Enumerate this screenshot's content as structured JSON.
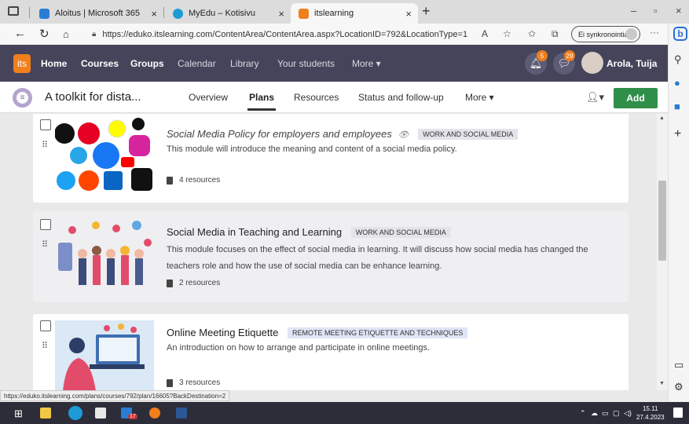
{
  "browser": {
    "tabs": [
      {
        "title": "Aloitus | Microsoft 365",
        "color": "#2b7cd3"
      },
      {
        "title": "MyEdu – Kotisivu",
        "color": "#1e9bd7"
      },
      {
        "title": "itslearning",
        "color": "#f07f1c"
      }
    ],
    "new_tab": "+",
    "url": "https://eduko.itslearning.com/ContentArea/ContentArea.aspx?LocationID=792&LocationType=1",
    "sync_label": "Ei synkronointia",
    "menu": "···"
  },
  "its_nav": {
    "logo": "its",
    "items": [
      "Home",
      "Courses",
      "Groups",
      "Calendar",
      "Library",
      "Your students",
      "More ▾"
    ],
    "notifications_count": "5",
    "messages_count": "29",
    "user_name": "Arola, Tuija"
  },
  "course": {
    "title": "A toolkit for dista...",
    "tabs": [
      "Overview",
      "Plans",
      "Resources",
      "Status and follow-up",
      "More ▾"
    ],
    "active_tab": "Plans",
    "add_label": "Add"
  },
  "modules": [
    {
      "title": "Social Media Policy for employers and employees",
      "tag": "WORK AND SOCIAL MEDIA",
      "description": "This module will introduce the meaning and content of a social media policy.",
      "resources": "4 resources"
    },
    {
      "title": "Social Media in Teaching and Learning",
      "tag": "WORK AND SOCIAL MEDIA",
      "description": "This module focuses on the effect of social media in learning. It will discuss how social media has changed the teachers role and how the use of social media can be enhance learning.",
      "resources": "2 resources"
    },
    {
      "title": "Online Meeting Etiquette",
      "tag": "REMOTE MEETING ETIQUETTE AND TECHNIQUES",
      "description": "An introduction on how to arrange and participate in online meetings.",
      "resources": "3 resources"
    }
  ],
  "status_url": "https://eduko.itslearning.com/plans/courses/792/plan/16605?BackDestination=2",
  "taskbar": {
    "badge": "17",
    "time": "15.11",
    "date": "27.4.2023"
  },
  "colors": {
    "its_header": "#45445a",
    "accent_orange": "#f07f1c",
    "add_green": "#2f8f4a"
  }
}
